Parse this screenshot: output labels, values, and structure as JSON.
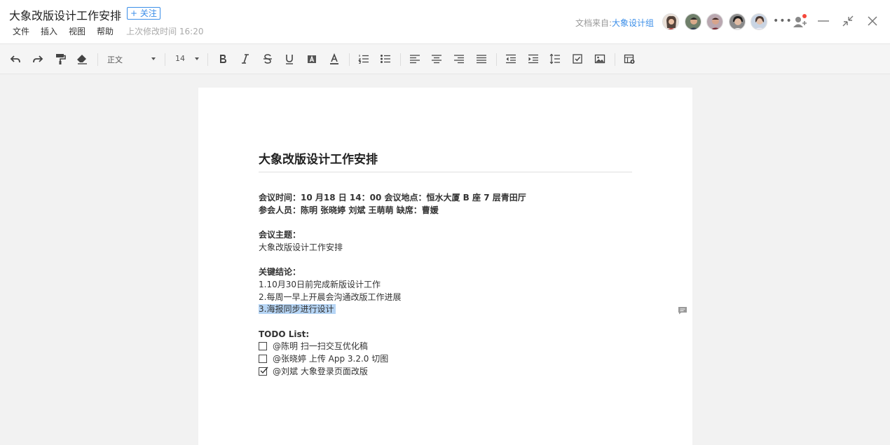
{
  "header": {
    "title": "大象改版设计工作安排",
    "follow_label": "+ 关注",
    "menus": [
      "文件",
      "插入",
      "视图",
      "帮助"
    ],
    "last_modified": "上次修改时间 16:20",
    "source_prefix": "文档来自:",
    "source_group": "大象设计组",
    "more_label": "•••"
  },
  "toolbar": {
    "style_select": "正文",
    "size_select": "14"
  },
  "doc": {
    "heading": "大象改版设计工作安排",
    "meeting_time_line": "会议时间：10 月18 日 14：00   会议地点：恒水大厦 B 座 7 层青田厅",
    "attendees_line": "参会人员：陈明 张晓婷 刘斌 王萌萌       缺席：曹媛",
    "topic_label": "会议主题：",
    "topic_value": "大象改版设计工作安排",
    "conclusion_label": "关键结论：",
    "conclusions": [
      "1.10月30日前完成新版设计工作",
      "2.每周一早上开晨会沟通改版工作进展",
      "3.海报同步进行设计"
    ],
    "todo_label": "TODO List:",
    "todos": [
      {
        "text": "@陈明 扫一扫交互优化稿",
        "checked": false
      },
      {
        "text": "@张晓婷 上传 App 3.2.0 切图",
        "checked": false
      },
      {
        "text": "@刘斌 大象登录页面改版",
        "checked": true
      }
    ]
  },
  "colors": {
    "accent": "#3b8ee8",
    "highlight": "#b6d5f5",
    "notification_dot": "#f5483b"
  }
}
